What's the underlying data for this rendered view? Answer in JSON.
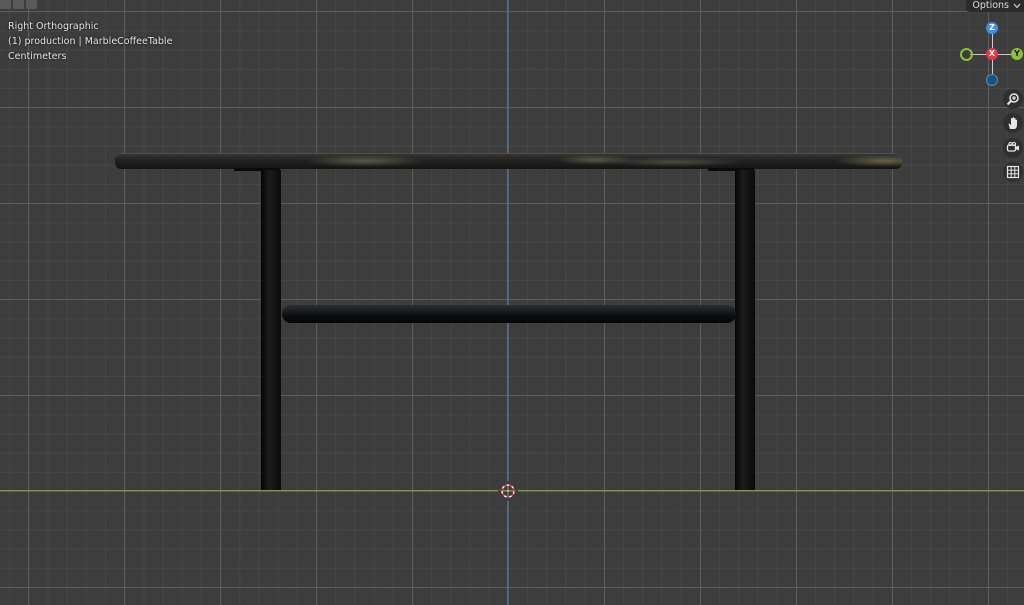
{
  "viewport": {
    "view_name": "Right Orthographic",
    "collection_object": "(1) production | MarbleCoffeeTable",
    "units": "Centimeters",
    "options_label": "Options",
    "axis_colors": {
      "x": "#e8364f",
      "y": "#8ac236",
      "z": "#3d8df0"
    }
  },
  "gizmo": {
    "z_label": "Z",
    "x_label": "X",
    "y_label": "Y"
  },
  "nav_buttons": [
    {
      "icon": "zoom-icon"
    },
    {
      "icon": "hand-pan-icon"
    },
    {
      "icon": "camera-icon"
    },
    {
      "icon": "grid-icon"
    }
  ],
  "scene": {
    "object": "MarbleCoffeeTable"
  }
}
